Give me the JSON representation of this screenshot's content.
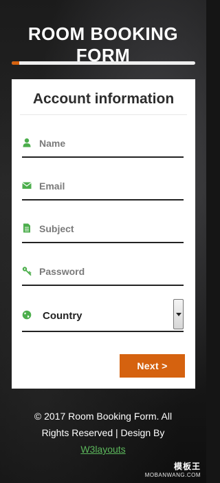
{
  "page_title": "ROOM BOOKING FORM",
  "progress": {
    "fraction": 0.04,
    "color": "#d5620f"
  },
  "form": {
    "section_title": "Account information",
    "fields": [
      {
        "icon": "user-icon",
        "placeholder": "Name"
      },
      {
        "icon": "envelope-icon",
        "placeholder": "Email"
      },
      {
        "icon": "file-icon",
        "placeholder": "Subject"
      },
      {
        "icon": "key-icon",
        "placeholder": "Password"
      }
    ],
    "country": {
      "icon": "globe-icon",
      "selected": "Country"
    },
    "next_label": "Next >"
  },
  "footer": {
    "copyright": "© 2017 Room Booking Form. All Rights Reserved | Design By",
    "link_text": "W3layouts"
  },
  "watermark": {
    "logo": "模板王",
    "url": "MOBANWANG.COM"
  },
  "colors": {
    "accent": "#d5620f",
    "icon_green": "#4cae4c",
    "link_green": "#5cb85c"
  }
}
